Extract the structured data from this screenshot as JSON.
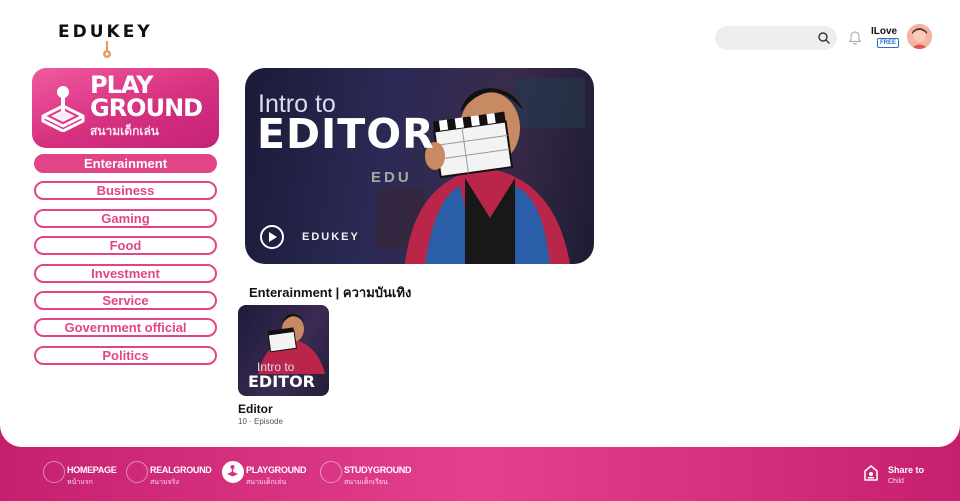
{
  "brand": {
    "logo_text": "EDUKEY"
  },
  "header": {
    "search_placeholder": "",
    "user_name": "ILove",
    "plan_badge": "FREE"
  },
  "playground_badge": {
    "title_line1": "PLAY",
    "title_line2": "GROUND",
    "subtitle": "สนามเด็กเล่น"
  },
  "categories": [
    {
      "label": "Enterainment",
      "active": true
    },
    {
      "label": "Business",
      "active": false
    },
    {
      "label": "Gaming",
      "active": false
    },
    {
      "label": "Food",
      "active": false
    },
    {
      "label": "Investment",
      "active": false
    },
    {
      "label": "Service",
      "active": false
    },
    {
      "label": "Government official",
      "active": false
    },
    {
      "label": "Politics",
      "active": false
    }
  ],
  "hero": {
    "intro": "Intro to",
    "title": "EDITOR",
    "brand_text": "EDUKEY",
    "brand_text_bg": "EDU"
  },
  "section": {
    "title": "Enterainment | ความบันเทิง"
  },
  "courses": [
    {
      "thumb_intro": "Intro to",
      "thumb_title": "EDITOR",
      "title": "Editor",
      "meta": "10 · Episode"
    }
  ],
  "bottom_nav": [
    {
      "label": "HOMEPAGE",
      "sub": "หน้าแรก",
      "active": false
    },
    {
      "label": "REALGROUND",
      "sub": "สนามจริง",
      "active": false
    },
    {
      "label": "PLAYGROUND",
      "sub": "สนามเด็กเล่น",
      "active": true
    },
    {
      "label": "STUDYGROUND",
      "sub": "สนามเด็กเรียน",
      "active": false
    }
  ],
  "share": {
    "label": "Share to",
    "sub": "Child"
  },
  "colors": {
    "accent": "#e24587",
    "nav_bg": "#d6307f",
    "plan_badge": "#2d6fc8"
  }
}
